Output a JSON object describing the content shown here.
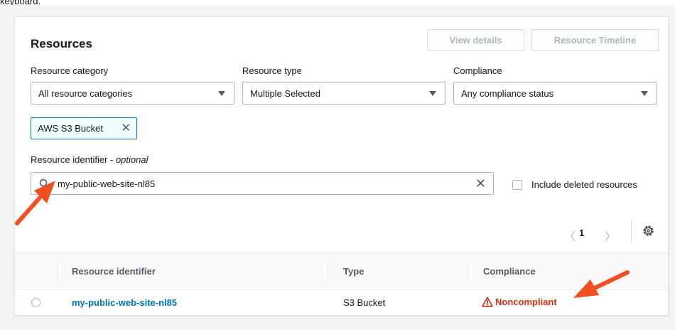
{
  "fragment": {
    "text": "keyboard."
  },
  "resources": {
    "title": "Resources",
    "view_details_label": "View details",
    "timeline_label": "Resource Timeline",
    "filters": {
      "category": {
        "label": "Resource category",
        "value": "All resource categories"
      },
      "type": {
        "label": "Resource type",
        "value": "Multiple Selected"
      },
      "compliance": {
        "label": "Compliance",
        "value": "Any compliance status"
      }
    },
    "token": {
      "label": "AWS S3 Bucket"
    },
    "identifier": {
      "label": "Resource identifier - ",
      "optional": "optional",
      "value": "my-public-web-site-nl85"
    },
    "include_deleted_label": "Include deleted resources",
    "pagination": {
      "current_page": "1"
    },
    "table": {
      "columns": [
        "Resource identifier",
        "Type",
        "Compliance"
      ],
      "rows": [
        {
          "identifier": "my-public-web-site-nl85",
          "type": "S3 Bucket",
          "compliance": "Noncompliant"
        }
      ]
    }
  },
  "colors": {
    "link": "#0073bb",
    "noncompliant": "#d13212",
    "annotation_arrow": "#f04e23"
  },
  "icons": [
    "search-icon",
    "clear-icon",
    "token-remove-icon",
    "caret-down-icon",
    "chevron-left-icon",
    "chevron-right-icon",
    "gear-icon",
    "warning-icon",
    "radio-icon"
  ]
}
